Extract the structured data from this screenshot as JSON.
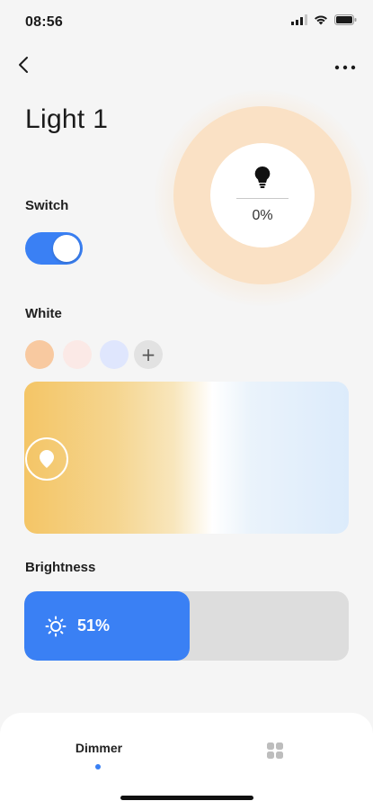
{
  "status": {
    "time": "08:56"
  },
  "header": {
    "title": "Light 1",
    "back_icon": "chevron-left-icon",
    "more_icon": "more-horizontal-icon"
  },
  "dial": {
    "value_text": "0%",
    "icon": "lightbulb-icon",
    "ring_color": "#fae1c5"
  },
  "switch": {
    "label": "Switch",
    "state": "on",
    "color": "#3a80f4"
  },
  "white": {
    "label": "White",
    "swatches": [
      "#f8c9a0",
      "#fbe9e6",
      "#dfe6fd"
    ],
    "add_icon": "plus-icon",
    "add_label": "+",
    "gradient": [
      "#f4c566",
      "#ffffff",
      "#dcebfb"
    ],
    "handle_position": 0.0
  },
  "brightness": {
    "label": "Brightness",
    "value_text": "51%",
    "fraction": 0.51,
    "icon": "sun-icon",
    "fill_color": "#3a80f4"
  },
  "bottom_nav": {
    "tabs": [
      {
        "label": "Dimmer",
        "active": true
      },
      {
        "label": "",
        "icon": "grid-icon",
        "active": false
      }
    ]
  }
}
